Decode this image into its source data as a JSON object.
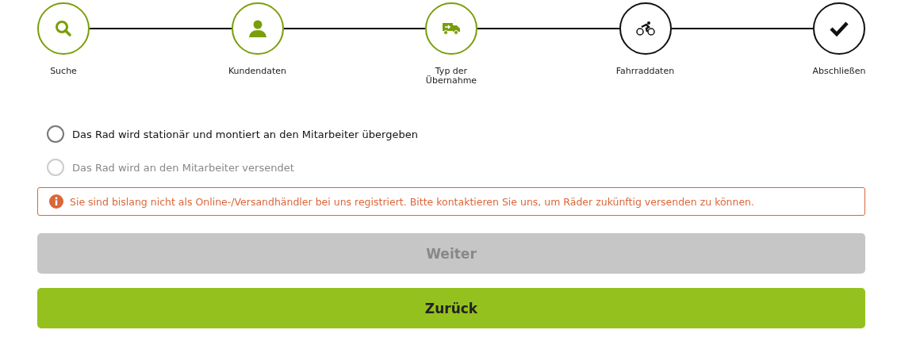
{
  "steps": [
    {
      "label": "Suche",
      "kind": "search",
      "done": true
    },
    {
      "label": "Kundendaten",
      "kind": "person",
      "done": true
    },
    {
      "label": "Typ der Übernahme",
      "kind": "truck",
      "done": true
    },
    {
      "label": "Fahrraddaten",
      "kind": "bike",
      "done": false
    },
    {
      "label": "Abschließen",
      "kind": "check",
      "done": false
    }
  ],
  "options": [
    {
      "label": "Das Rad wird stationär und montiert an den Mitarbeiter übergeben",
      "selected": false,
      "disabled": false
    },
    {
      "label": "Das Rad wird an den Mitarbeiter versendet",
      "selected": false,
      "disabled": true
    }
  ],
  "alert": {
    "text": "Sie sind bislang nicht als Online-/Versandhändler bei uns registriert. Bitte kontaktieren Sie uns, um Räder zukünftig versenden zu können."
  },
  "buttons": [
    {
      "label": "Weiter",
      "kind": "next",
      "disabled": true
    },
    {
      "label": "Zurück",
      "kind": "back",
      "disabled": false
    }
  ]
}
